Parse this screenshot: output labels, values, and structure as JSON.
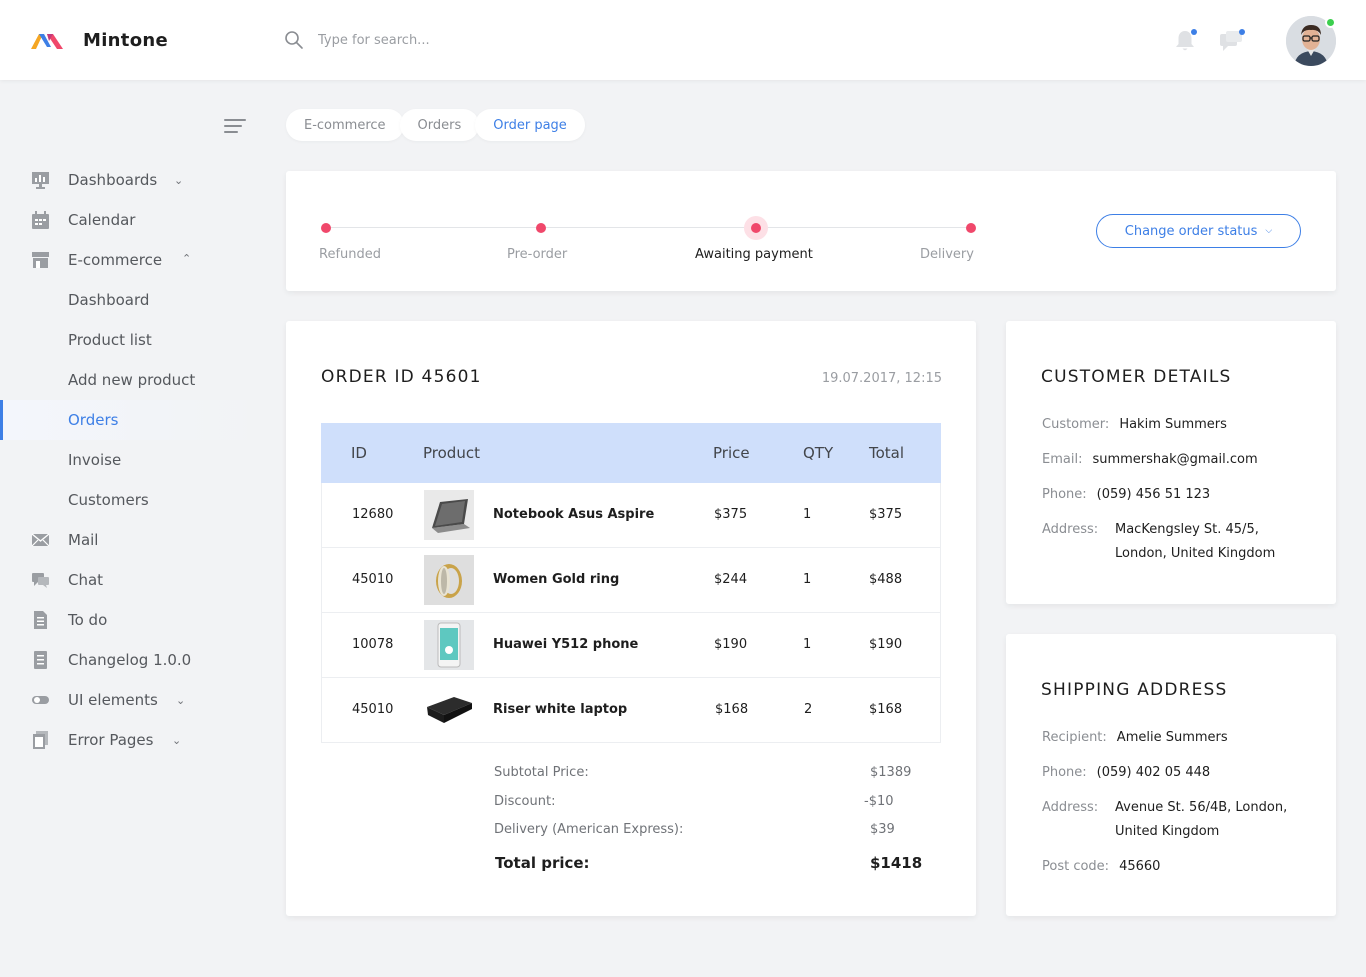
{
  "app": {
    "name": "Mintone",
    "brand_colors": [
      "#f5a623",
      "#f0486b",
      "#3d7fe6"
    ],
    "accent": "#3d7fe6"
  },
  "header": {
    "search_placeholder": "Type for search...",
    "icons": [
      "search-icon",
      "bell-icon",
      "chat-icon"
    ],
    "notification_dot_color": "#3d7fe6",
    "online_status_color": "#3ccf4e"
  },
  "sidebar": {
    "items": [
      {
        "label": "Dashboards",
        "icon": "dashboard-icon",
        "expandable": true,
        "expanded": false
      },
      {
        "label": "Calendar",
        "icon": "calendar-icon"
      },
      {
        "label": "E-commerce",
        "icon": "shop-icon",
        "expandable": true,
        "expanded": true
      },
      {
        "label": "Dashboard",
        "sub": true
      },
      {
        "label": "Product list",
        "sub": true
      },
      {
        "label": "Add new product",
        "sub": true
      },
      {
        "label": "Orders",
        "sub": true,
        "active": true
      },
      {
        "label": "Invoise",
        "sub": true
      },
      {
        "label": "Customers",
        "sub": true
      },
      {
        "label": "Mail",
        "icon": "mail-icon"
      },
      {
        "label": "Chat",
        "icon": "chat-icon"
      },
      {
        "label": "To do",
        "icon": "todo-icon"
      },
      {
        "label": "Changelog 1.0.0",
        "icon": "changelog-icon"
      },
      {
        "label": "UI elements",
        "icon": "toggle-icon",
        "expandable": true,
        "expanded": false
      },
      {
        "label": "Error Pages",
        "icon": "pages-icon",
        "expandable": true,
        "expanded": false
      }
    ]
  },
  "breadcrumb": [
    "E-commerce",
    "Orders",
    "Order page"
  ],
  "status": {
    "steps": [
      "Refunded",
      "Pre-order",
      "Awaiting payment",
      "Delivery"
    ],
    "current_step": "Awaiting payment",
    "step_color": "#f0486b",
    "button_label": "Change order status"
  },
  "order": {
    "title": "ORDER ID 45601",
    "date": "19.07.2017, 12:15",
    "columns": [
      "ID",
      "Product",
      "Price",
      "QTY",
      "Total"
    ],
    "rows": [
      {
        "id": "12680",
        "product": "Notebook Asus Aspire",
        "price": "$375",
        "qty": "1",
        "total": "$375",
        "image": "laptop"
      },
      {
        "id": "45010",
        "product": "Women Gold ring",
        "price": "$244",
        "qty": "1",
        "total": "$488",
        "image": "ring"
      },
      {
        "id": "10078",
        "product": "Huawei Y512 phone",
        "price": "$190",
        "qty": "1",
        "total": "$190",
        "image": "phone"
      },
      {
        "id": "45010",
        "product": "Riser white laptop",
        "price": "$168",
        "qty": "2",
        "total": "$168",
        "image": "stand"
      }
    ],
    "summary": [
      {
        "label": "Subtotal Price:",
        "value": "$1389"
      },
      {
        "label": "Discount:",
        "value": "-$10"
      },
      {
        "label": "Delivery (American Express):",
        "value": "$39"
      }
    ],
    "total_label": "Total price:",
    "total_value": "$1418",
    "header_color": "#cfdffb"
  },
  "customer": {
    "title": "CUSTOMER DETAILS",
    "customer_label": "Customer:",
    "customer": "Hakim Summers",
    "email_label": "Email:",
    "email": "summershak@gmail.com",
    "phone_label": "Phone:",
    "phone": "(059) 456 51 123",
    "address_label": "Address:",
    "address_line1": "MacKengsley St. 45/5,",
    "address_line2": "London, United Kingdom"
  },
  "shipping": {
    "title": "SHIPPING ADDRESS",
    "recipient_label": "Recipient:",
    "recipient": "Amelie Summers",
    "phone_label": "Phone:",
    "phone": "(059) 402 05 448",
    "address_label": "Address:",
    "address_line1": "Avenue St. 56/4B, London,",
    "address_line2": "United Kingdom",
    "postcode_label": "Post code:",
    "postcode": "45660"
  }
}
